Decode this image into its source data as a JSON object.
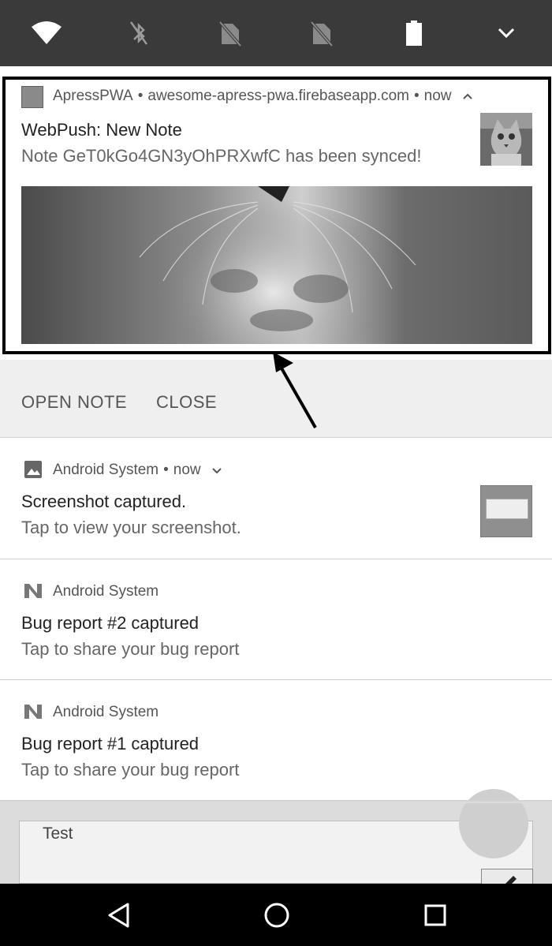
{
  "colors": {
    "status_bar": "#3a3a3a",
    "highlight_border": "#000000",
    "actions_background": "#efefef",
    "nav_bar": "#000000"
  },
  "quick_settings": {
    "icons": [
      "wifi-icon",
      "bluetooth-off-icon",
      "no-sim-icon",
      "no-sim-icon",
      "battery-icon",
      "chevron-down-icon"
    ]
  },
  "notification_pwa": {
    "app_name": "ApressPWA",
    "separator": "•",
    "origin": "awesome-apress-pwa.firebaseapp.com",
    "time": "now",
    "title": "WebPush: New Note",
    "text": "Note GeT0kGo4GN3yOhPRXwfC has been synced!",
    "actions": [
      "OPEN NOTE",
      "CLOSE"
    ]
  },
  "notification_screenshot": {
    "app_name": "Android System",
    "separator": "•",
    "time": "now",
    "title": "Screenshot captured.",
    "text": "Tap to view your screenshot."
  },
  "notification_bug2": {
    "app_name": "Android System",
    "title": "Bug report #2 captured",
    "text": "Tap to share your bug report"
  },
  "notification_bug1": {
    "app_name": "Android System",
    "title": "Bug report #1 captured",
    "text": "Tap to share your bug report"
  },
  "background_app": {
    "note_text": "Test"
  },
  "nav_bar": {
    "icons": [
      "back-icon",
      "home-icon",
      "recents-icon"
    ]
  }
}
